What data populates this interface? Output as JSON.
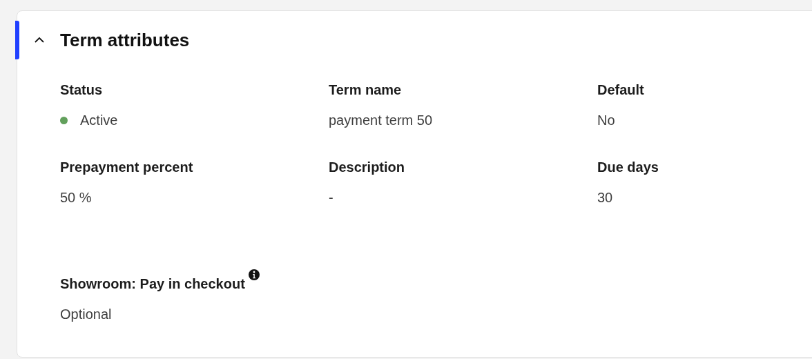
{
  "section": {
    "title": "Term attributes",
    "expanded": true
  },
  "groups": [
    {
      "fields": [
        {
          "label": "Status",
          "value": "Active",
          "kind": "status",
          "color": "#62a05c"
        },
        {
          "label": "Term name",
          "value": "payment term 50",
          "kind": "text"
        },
        {
          "label": "Default",
          "value": "No",
          "kind": "text"
        },
        {
          "label": "Prepayment percent",
          "value": "50 %",
          "kind": "text"
        },
        {
          "label": "Description",
          "value": "-",
          "kind": "text"
        },
        {
          "label": "Due days",
          "value": "30",
          "kind": "text"
        }
      ]
    },
    {
      "fields": [
        {
          "label": "Showroom: Pay in checkout",
          "value": "Optional",
          "kind": "text",
          "info": true
        }
      ]
    }
  ]
}
